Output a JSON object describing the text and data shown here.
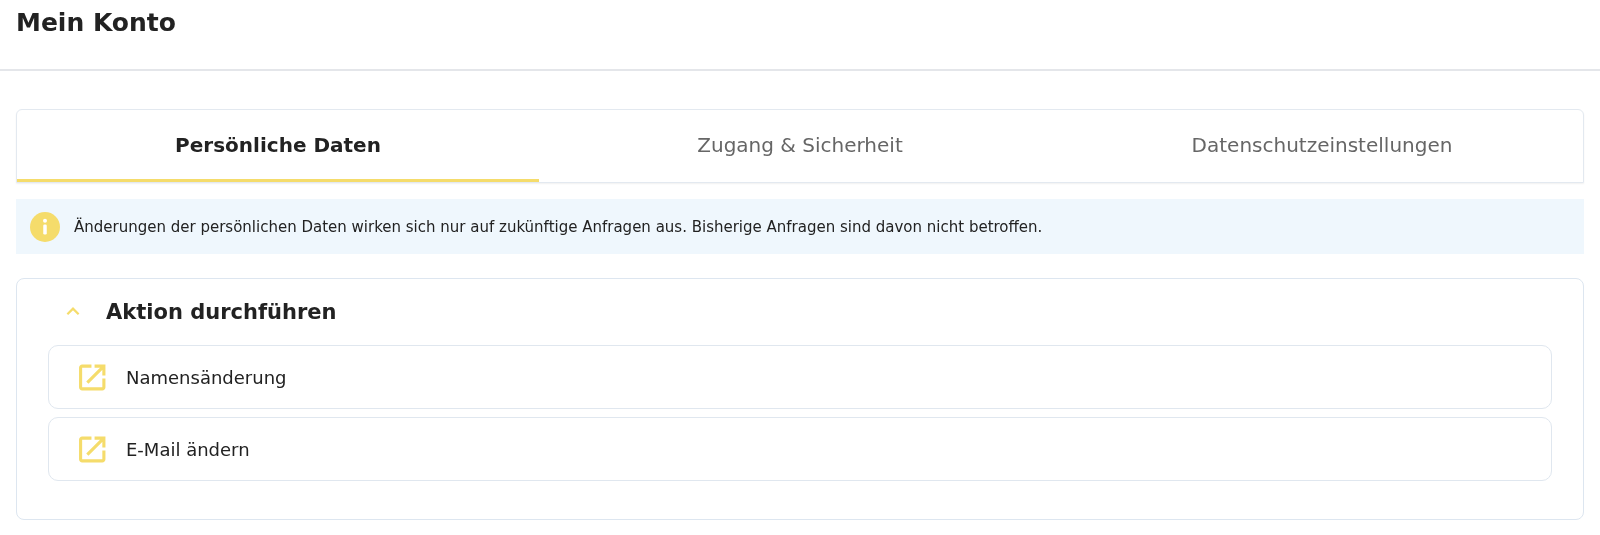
{
  "page": {
    "title": "Mein Konto"
  },
  "tabs": [
    {
      "label": "Persönliche Daten",
      "selected": true
    },
    {
      "label": "Zugang & Sicherheit",
      "selected": false
    },
    {
      "label": "Datenschutzeinstellungen",
      "selected": false
    }
  ],
  "notice": {
    "text": "Änderungen der persönlichen Daten wirken sich nur auf zukünftige Anfragen aus. Bisherige Anfragen sind davon nicht betroffen."
  },
  "section": {
    "title": "Aktion durchführen",
    "expanded": true,
    "actions": [
      {
        "label": "Namensänderung"
      },
      {
        "label": "E-Mail ändern"
      }
    ]
  }
}
